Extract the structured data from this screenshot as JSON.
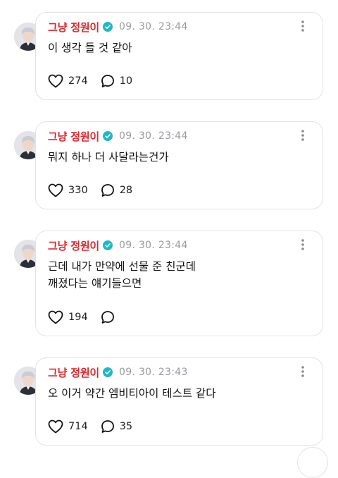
{
  "colors": {
    "author_name": "#e0262b",
    "verified_badge": "#1fb8c9",
    "timestamp": "#9a9aa0",
    "card_border": "#e3e3e6"
  },
  "posts": [
    {
      "author": "그냥 정원이",
      "timestamp": "09. 30. 23:44",
      "text": "이 생각 들 것 같아",
      "likes": "274",
      "comments": "10"
    },
    {
      "author": "그냥 정원이",
      "timestamp": "09. 30. 23:44",
      "text": "뭐지 하나 더 사달라는건가",
      "likes": "330",
      "comments": "28"
    },
    {
      "author": "그냥 정원이",
      "timestamp": "09. 30. 23:44",
      "text": "근데 내가 만약에 선물 준 친군데\n깨졌다는 얘기들으면",
      "likes": "194",
      "comments": ""
    },
    {
      "author": "그냥 정원이",
      "timestamp": "09. 30. 23:43",
      "text": "오 이거 약간 엠비티아이 테스트 같다",
      "likes": "714",
      "comments": "35"
    }
  ],
  "icons": {
    "verified": "verified-check-icon",
    "more": "more-vertical-icon",
    "like": "heart-outline-icon",
    "comment": "speech-bubble-icon"
  }
}
